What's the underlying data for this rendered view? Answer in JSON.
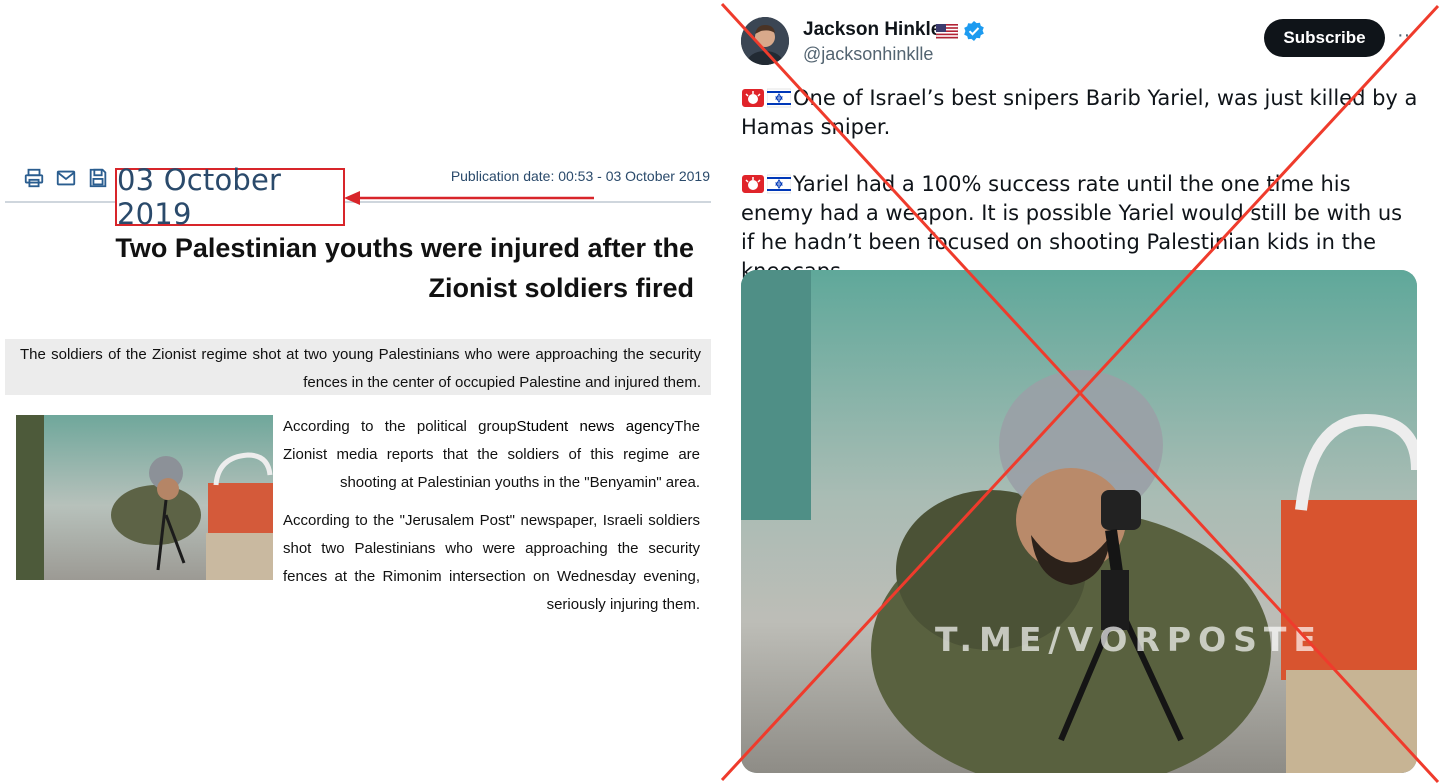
{
  "article": {
    "publication_date": "Publication date: 00:53 - 03 October 2019",
    "date_highlight": "03 October 2019",
    "headline": "Two Palestinian youths were injured after the Zionist soldiers fired",
    "lead": "The soldiers of the Zionist regime shot at two young Palestinians who were approaching the security fences in the center of occupied Palestine and injured them.",
    "para1_before": "According to the political group",
    "para1_agency": "Student news agency",
    "para1_after": "The Zionist media reports that the soldiers of this regime are shooting at Palestinian youths in the \"Benyamin\" area.",
    "para2": "According to the \"Jerusalem Post\" newspaper, Israeli soldiers shot two Palestinians who were approaching the security fences at the Rimonim intersection on Wednesday evening, seriously injuring them.",
    "toolbar_icons": [
      "print-icon",
      "email-icon",
      "save-icon",
      "more-icon"
    ]
  },
  "tweet": {
    "author_name": "Jackson Hinkle",
    "author_handle": "@jacksonhinklle",
    "subscribe_label": "Subscribe",
    "more_label": "··",
    "para1": "One of Israel’s best snipers Barib Yariel, was just killed by a Hamas sniper.",
    "para2": "Yariel had a 100% success rate until the one time his enemy had a weapon. It is possible Yariel would still be with us if he hadn’t been focused on shooting Palestinian kids in the kneecaps.",
    "emoji_icons": [
      "siren-icon",
      "israel-flag-icon"
    ],
    "media_watermark": "T.ME/VORPOSTE"
  },
  "colors": {
    "highlight_red": "#d8252a",
    "cross_red": "#ef3b2c",
    "date_blue": "#2a4a6b",
    "subscribe_bg": "#0f1419",
    "verified_blue": "#1d9bf0"
  }
}
